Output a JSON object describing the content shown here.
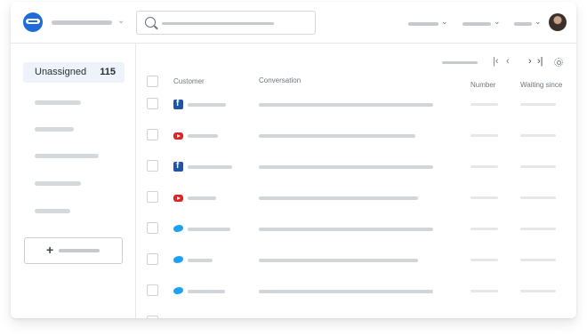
{
  "sidebar": {
    "active_item": {
      "label": "Unassigned",
      "count": "115"
    },
    "placeholder_items": 5,
    "new_button_icon": "+"
  },
  "table": {
    "headers": {
      "customer": "Customer",
      "conversation": "Conversation",
      "number": "Number",
      "waiting": "Waiting since"
    },
    "rows": [
      {
        "channel": "facebook-icon"
      },
      {
        "channel": "youtube-icon"
      },
      {
        "channel": "facebook-icon"
      },
      {
        "channel": "youtube-icon"
      },
      {
        "channel": "twitter-icon"
      },
      {
        "channel": "twitter-icon"
      },
      {
        "channel": "twitter-icon"
      }
    ]
  },
  "pager": {
    "first": "|‹",
    "prev": "‹",
    "next": "›",
    "last": "›|"
  },
  "icons": {
    "logo": "chat-bot-logo-icon",
    "search": "search-icon",
    "settings": "gear-icon",
    "avatar": "user-avatar"
  },
  "colors": {
    "accent": "#1f6bd8",
    "active_bg": "#eef3fb",
    "facebook": "#1f55a8",
    "youtube": "#e32222",
    "twitter": "#1da1f2"
  }
}
